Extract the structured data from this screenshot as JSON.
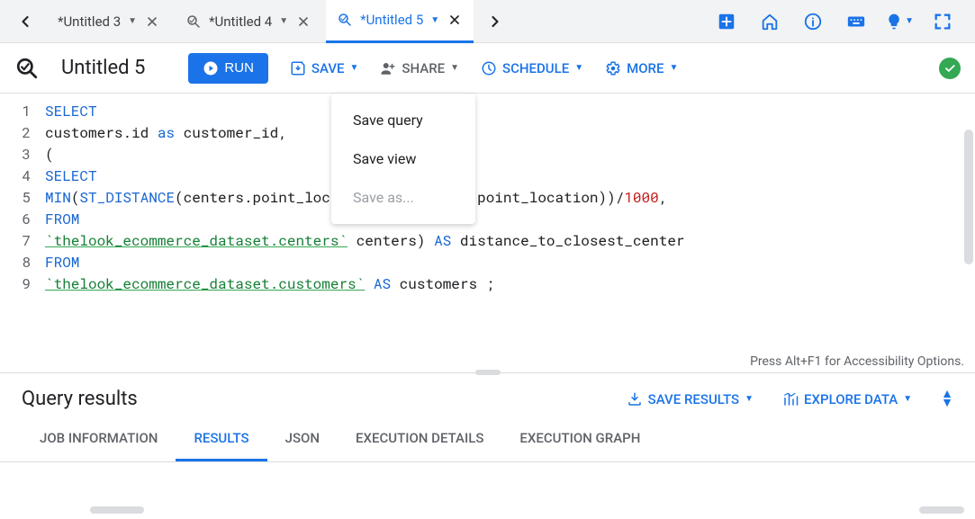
{
  "tabs": [
    {
      "label": "*Untitled 3",
      "active": false
    },
    {
      "label": "*Untitled 4",
      "active": false
    },
    {
      "label": "*Untitled 5",
      "active": true
    }
  ],
  "toolbar": {
    "doc_title": "Untitled 5",
    "run_label": "RUN",
    "save_label": "SAVE",
    "share_label": "SHARE",
    "schedule_label": "SCHEDULE",
    "more_label": "MORE"
  },
  "save_menu": {
    "save_query": "Save query",
    "save_view": "Save view",
    "save_as": "Save as..."
  },
  "editor": {
    "lines": [
      "1",
      "2",
      "3",
      "4",
      "5",
      "6",
      "7",
      "8",
      "9"
    ],
    "hint": "Press Alt+F1 for Accessibility Options.",
    "code": {
      "l1_select": "SELECT",
      "l2_a": "customers.id ",
      "l2_as": "as",
      "l2_b": " customer_id,",
      "l3": "(",
      "l4_select": "SELECT",
      "l5_min": "MIN",
      "l5_lp": "(",
      "l5_std": "ST_DISTANCE",
      "l5_mid": "(centers.point_location, customers.point_location))/",
      "l5_num": "1000",
      "l5_comma": ",",
      "l6_from": "FROM",
      "l7_str": "`thelook_ecommerce_dataset.centers`",
      "l7_mid": " centers) ",
      "l7_as": "AS",
      "l7_end": " distance_to_closest_center",
      "l8_from": "FROM",
      "l9_str": "`thelook_ecommerce_dataset.customers`",
      "l9_sp": " ",
      "l9_as": "AS",
      "l9_end": " customers ;"
    }
  },
  "results": {
    "title": "Query results",
    "save_results_label": "SAVE RESULTS",
    "explore_label": "EXPLORE DATA",
    "tabs": {
      "job": "JOB INFORMATION",
      "results": "RESULTS",
      "json": "JSON",
      "exec_details": "EXECUTION DETAILS",
      "exec_graph": "EXECUTION GRAPH"
    }
  }
}
